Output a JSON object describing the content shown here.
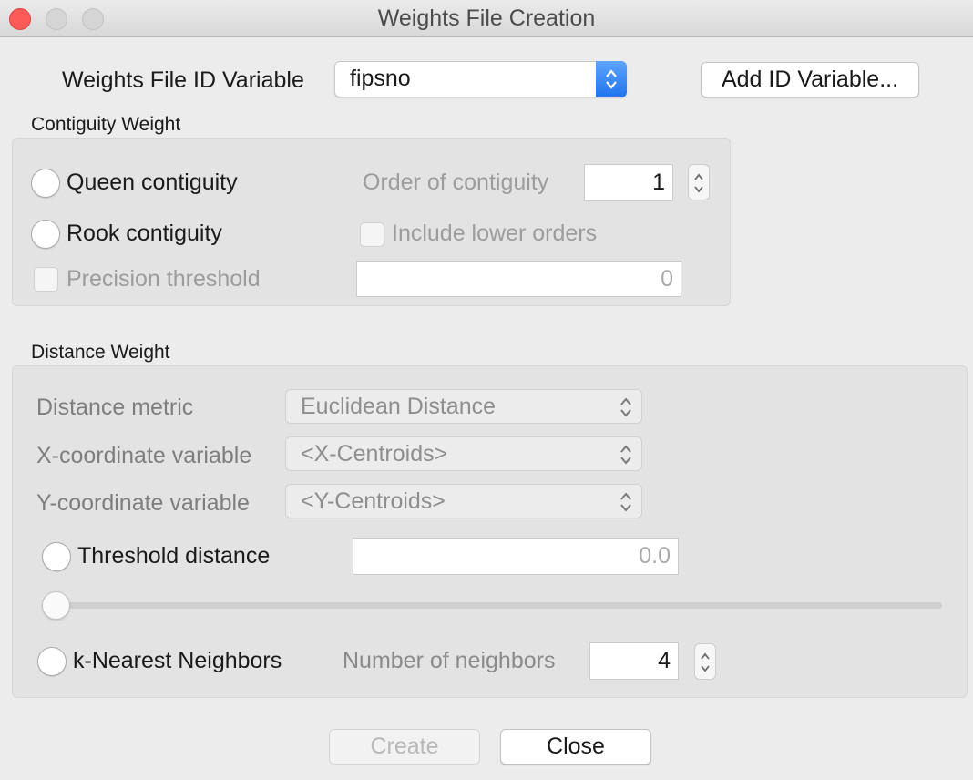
{
  "window": {
    "title": "Weights File Creation"
  },
  "id_variable": {
    "label": "Weights File ID Variable",
    "value": "fipsno",
    "add_button": "Add ID Variable..."
  },
  "contiguity": {
    "group_label": "Contiguity Weight",
    "queen_label": "Queen contiguity",
    "rook_label": "Rook contiguity",
    "precision_label": "Precision threshold",
    "precision_value": "0",
    "order_label": "Order of contiguity",
    "order_value": "1",
    "include_lower_label": "Include lower orders"
  },
  "distance": {
    "group_label": "Distance Weight",
    "metric_label": "Distance metric",
    "metric_value": "Euclidean Distance",
    "x_label": "X-coordinate variable",
    "x_value": "<X-Centroids>",
    "y_label": "Y-coordinate variable",
    "y_value": "<Y-Centroids>",
    "threshold_label": "Threshold distance",
    "threshold_value": "0.0",
    "threshold_slider_level": 0,
    "knn_label": "k-Nearest Neighbors",
    "neighbors_label": "Number of neighbors",
    "neighbors_value": "4"
  },
  "footer": {
    "create": "Create",
    "close": "Close"
  },
  "colors": {
    "close_light": "#fc5b57",
    "accent_blue": "#1f73ee"
  }
}
